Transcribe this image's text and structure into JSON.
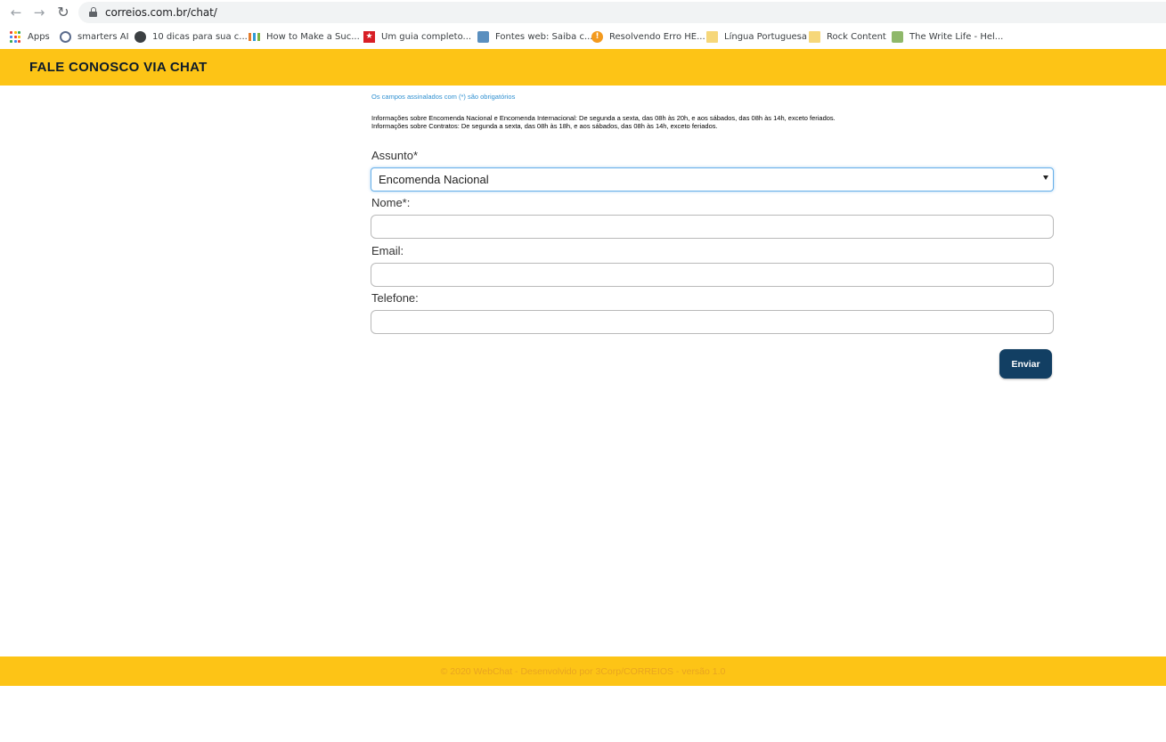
{
  "browser": {
    "url": "correios.com.br/chat/",
    "bookmarks": [
      {
        "label": "Apps",
        "icon": "apps-grid-icon"
      },
      {
        "label": "smarters AI",
        "icon": "smarters-icon"
      },
      {
        "label": "10 dicas para sua c...",
        "icon": "globe-icon"
      },
      {
        "label": "How to Make a Suc...",
        "icon": "bars-icon"
      },
      {
        "label": "Um guia completo...",
        "icon": "star-red-icon"
      },
      {
        "label": "Fontes web: Saiba c...",
        "icon": "fontes-icon"
      },
      {
        "label": "Resolvendo Erro HE...",
        "icon": "warning-orange-icon"
      },
      {
        "label": "Língua Portuguesa",
        "icon": "folder-icon"
      },
      {
        "label": "Rock Content",
        "icon": "folder-icon"
      },
      {
        "label": "The Write Life - Hel...",
        "icon": "writelife-icon"
      }
    ]
  },
  "header": {
    "title": "FALE CONOSCO VIA CHAT"
  },
  "form": {
    "required_note": "Os campos assinalados com (*) são obrigatórios",
    "info_national": "Informações sobre Encomenda Nacional e Encomenda Internacional: De segunda a sexta, das 08h às 20h, e aos sábados, das 08h às 14h, exceto feriados.",
    "info_contracts": "Informações sobre Contratos: De segunda a sexta, das 08h às 18h, e aos sábados, das 08h às 14h, exceto feriados.",
    "subject_label": "Assunto*",
    "subject_value": "Encomenda Nacional",
    "name_label": "Nome*:",
    "name_value": "",
    "email_label": "Email:",
    "email_value": "",
    "phone_label": "Telefone:",
    "phone_value": "",
    "submit_label": "Enviar"
  },
  "footer": {
    "text": "© 2020 WebChat - Desenvolvido por 3Corp/CORREIOS - versão 1.0"
  },
  "colors": {
    "brand_yellow": "#fdc416",
    "button_navy": "#123f63",
    "note_blue": "#2e8fd0"
  }
}
